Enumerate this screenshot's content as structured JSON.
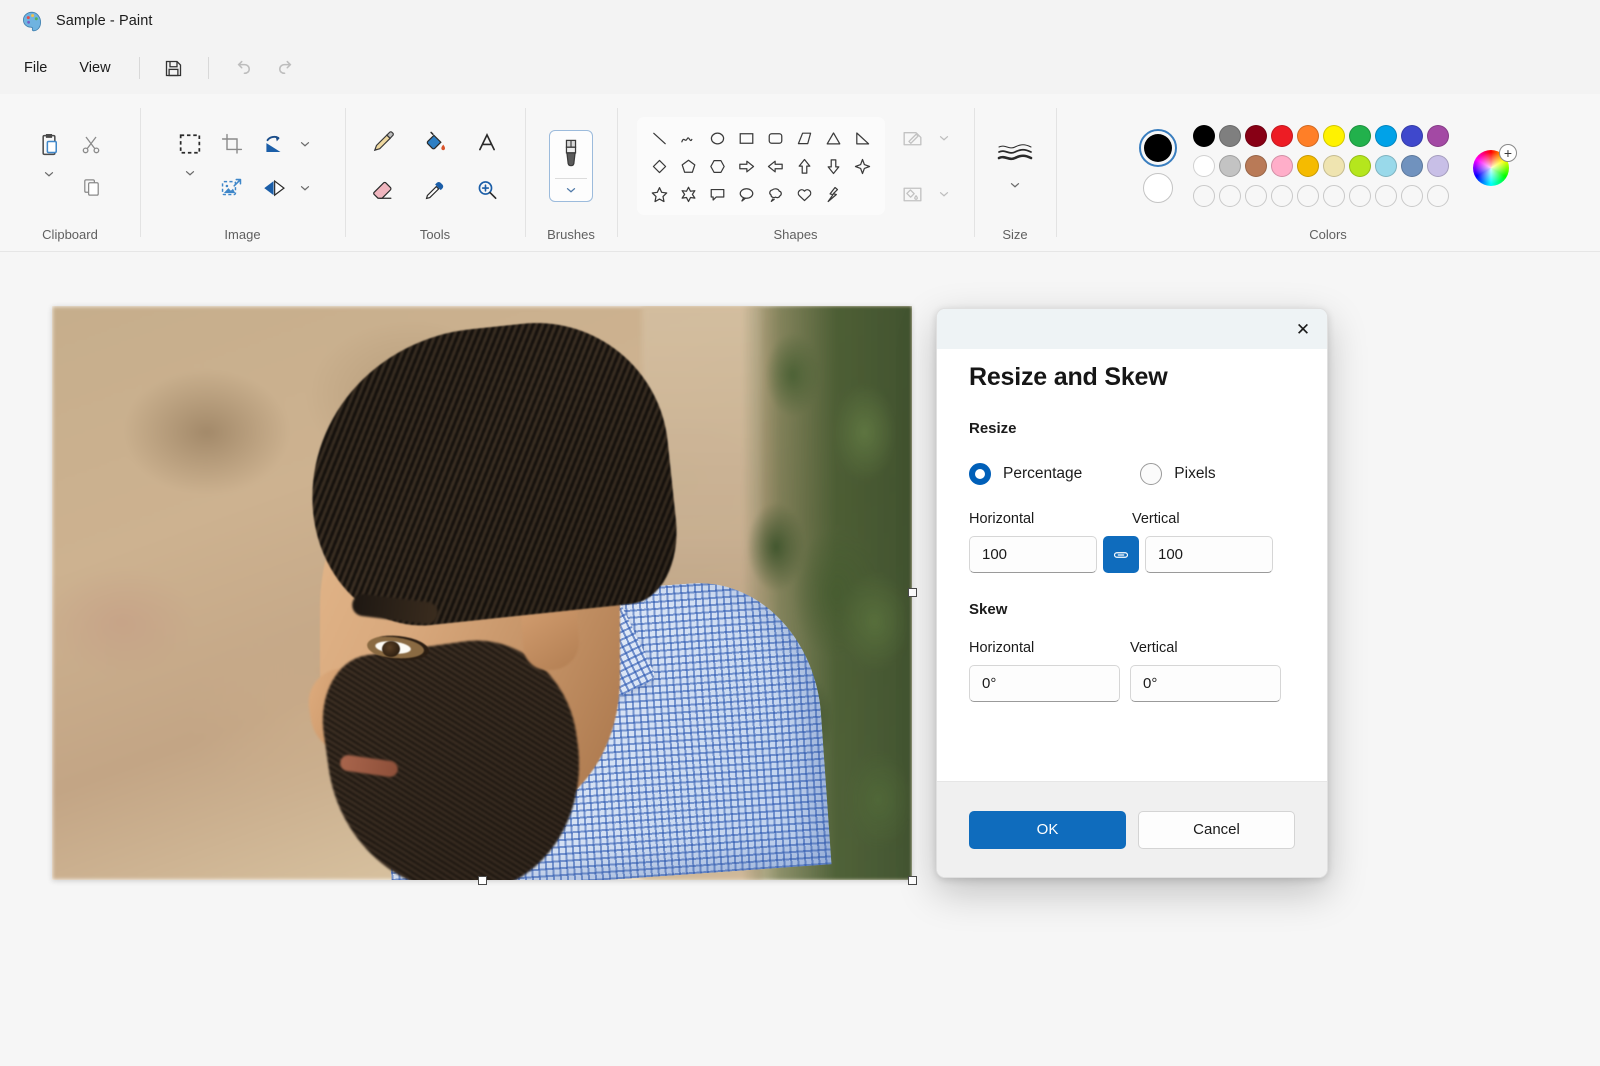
{
  "window": {
    "title": "Sample - Paint",
    "app_icon": "paint-palette-icon"
  },
  "menubar": {
    "items": [
      {
        "label": "File",
        "name": "menu-file"
      },
      {
        "label": "View",
        "name": "menu-view"
      }
    ],
    "quick_access": [
      {
        "name": "save-icon",
        "tooltip": "Save"
      },
      {
        "name": "undo-icon",
        "tooltip": "Undo"
      },
      {
        "name": "redo-icon",
        "tooltip": "Redo"
      }
    ]
  },
  "ribbon": {
    "groups": [
      {
        "name": "clipboard",
        "label": "Clipboard",
        "items": [
          {
            "name": "paste-icon",
            "label": "Paste"
          },
          {
            "name": "cut-scissors-icon",
            "label": "Cut"
          },
          {
            "name": "copy-icon",
            "label": "Copy"
          },
          {
            "name": "chevron-down-icon",
            "label": "Paste options"
          }
        ]
      },
      {
        "name": "image",
        "label": "Image",
        "items": [
          {
            "name": "select-rectangle-icon",
            "label": "Select"
          },
          {
            "name": "chevron-down-icon",
            "label": "Select options"
          },
          {
            "name": "crop-icon",
            "label": "Crop"
          },
          {
            "name": "resize-skew-icon",
            "label": "Resize and skew"
          },
          {
            "name": "rotate-icon",
            "label": "Rotate"
          },
          {
            "name": "chevron-down-icon",
            "label": "Rotate options"
          },
          {
            "name": "flip-icon",
            "label": "Flip"
          },
          {
            "name": "chevron-down-icon",
            "label": "Flip options"
          }
        ]
      },
      {
        "name": "tools",
        "label": "Tools",
        "items": [
          {
            "name": "pencil-icon",
            "label": "Pencil"
          },
          {
            "name": "fill-bucket-icon",
            "label": "Fill with color"
          },
          {
            "name": "text-icon",
            "label": "Text"
          },
          {
            "name": "eraser-icon",
            "label": "Eraser"
          },
          {
            "name": "eyedropper-icon",
            "label": "Color picker"
          },
          {
            "name": "magnifier-icon",
            "label": "Magnifier"
          }
        ]
      },
      {
        "name": "brushes",
        "label": "Brushes",
        "items": [
          {
            "name": "brush-icon",
            "label": "Brushes"
          },
          {
            "name": "chevron-down-icon",
            "label": "Brush options"
          }
        ]
      },
      {
        "name": "shapes",
        "label": "Shapes",
        "items": [
          {
            "name": "shape-line-icon",
            "label": "Line"
          },
          {
            "name": "shape-curve-icon",
            "label": "Curve"
          },
          {
            "name": "shape-oval-icon",
            "label": "Oval"
          },
          {
            "name": "shape-rectangle-icon",
            "label": "Rectangle"
          },
          {
            "name": "shape-rounded-rectangle-icon",
            "label": "Rounded rectangle"
          },
          {
            "name": "shape-right-triangle-icon",
            "label": "Right triangle"
          },
          {
            "name": "shape-triangle-icon",
            "label": "Triangle"
          },
          {
            "name": "shape-diagonal-triangle-icon",
            "label": "Diagonal triangle"
          },
          {
            "name": "shape-diamond-icon",
            "label": "Diamond"
          },
          {
            "name": "shape-pentagon-icon",
            "label": "Pentagon"
          },
          {
            "name": "shape-hexagon-icon",
            "label": "Hexagon"
          },
          {
            "name": "shape-right-arrow-icon",
            "label": "Right arrow"
          },
          {
            "name": "shape-left-arrow-icon",
            "label": "Left arrow"
          },
          {
            "name": "shape-up-arrow-icon",
            "label": "Up arrow"
          },
          {
            "name": "shape-down-arrow-icon",
            "label": "Down arrow"
          },
          {
            "name": "shape-four-point-star-icon",
            "label": "Four-point star"
          },
          {
            "name": "shape-five-point-star-icon",
            "label": "Five-point star"
          },
          {
            "name": "shape-six-point-star-icon",
            "label": "Six-point star"
          },
          {
            "name": "shape-rounded-callout-icon",
            "label": "Rounded rectangular callout"
          },
          {
            "name": "shape-oval-callout-icon",
            "label": "Oval callout"
          },
          {
            "name": "shape-cloud-callout-icon",
            "label": "Cloud callout"
          },
          {
            "name": "shape-heart-icon",
            "label": "Heart"
          },
          {
            "name": "shape-lightning-icon",
            "label": "Lightning"
          }
        ],
        "side_items": [
          {
            "name": "shape-outline-icon",
            "label": "Outline"
          },
          {
            "name": "chevron-down-icon",
            "label": "Outline options"
          },
          {
            "name": "shape-fill-icon",
            "label": "Fill"
          },
          {
            "name": "chevron-down-icon",
            "label": "Fill options"
          }
        ]
      },
      {
        "name": "size",
        "label": "Size",
        "items": [
          {
            "name": "size-lines-icon",
            "label": "Size"
          },
          {
            "name": "chevron-down-icon",
            "label": "Size options"
          }
        ]
      },
      {
        "name": "colors",
        "label": "Colors",
        "current": {
          "primary": "#000000",
          "secondary": "#ffffff",
          "primary_name": "color-1-primary",
          "secondary_name": "color-2-secondary"
        },
        "palette_row1": [
          "#000000",
          "#7f7f7f",
          "#880015",
          "#ed1c24",
          "#ff7f27",
          "#fff200",
          "#22b14c",
          "#00a2e8",
          "#3f48cc",
          "#a349a4"
        ],
        "palette_row2": [
          "#ffffff",
          "#c3c3c3",
          "#b97a57",
          "#ffaec9",
          "#f5bb00",
          "#efe4b0",
          "#b5e61d",
          "#99d9ea",
          "#7092be",
          "#c8bfe7"
        ],
        "palette_row3": [
          "",
          "",
          "",
          "",
          "",
          "",
          "",
          "",
          "",
          ""
        ],
        "wheel": {
          "name": "color-wheel-icon",
          "label": "Edit colors"
        }
      }
    ]
  },
  "canvas": {
    "image_alt": "Photograph of a bearded man in profile wearing a blue checked shirt, rocky wall and green cypress foliage behind",
    "selection_handles": 8
  },
  "dialog": {
    "title": "Resize and Skew",
    "close_label": "✕",
    "resize": {
      "section_label": "Resize",
      "options": [
        {
          "label": "Percentage",
          "selected": true,
          "name": "radio-percentage"
        },
        {
          "label": "Pixels",
          "selected": false,
          "name": "radio-pixels"
        }
      ],
      "horizontal_label": "Horizontal",
      "vertical_label": "Vertical",
      "horizontal_value": "100",
      "vertical_value": "100",
      "link_icon": "link-aspect-ratio-icon"
    },
    "skew": {
      "section_label": "Skew",
      "horizontal_label": "Horizontal",
      "vertical_label": "Vertical",
      "horizontal_value": "0°",
      "vertical_value": "0°"
    },
    "footer": {
      "ok_label": "OK",
      "cancel_label": "Cancel"
    }
  },
  "theme": {
    "accent": "#0f6cbd",
    "radio_accent": "#005fb8",
    "ribbon_bg": "#f7f7f7",
    "dialog_header_bg": "#eef3f5"
  }
}
